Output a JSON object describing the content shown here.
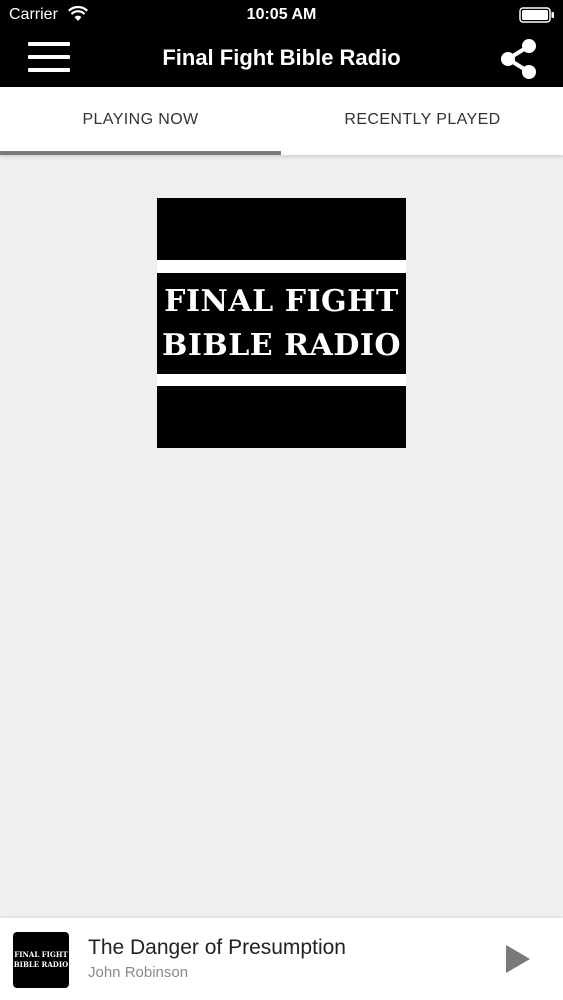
{
  "status_bar": {
    "carrier": "Carrier",
    "time": "10:05 AM"
  },
  "nav": {
    "title": "Final Fight Bible Radio",
    "menu_icon": "hamburger-menu-icon",
    "share_icon": "share-icon"
  },
  "tabs": [
    {
      "label": "PLAYING NOW",
      "active": true
    },
    {
      "label": "RECENTLY PLAYED",
      "active": false
    }
  ],
  "artwork": {
    "line1": "FINAL FIGHT",
    "line2": "BIBLE RADIO"
  },
  "mini_player": {
    "title": "The Danger of Presumption",
    "artist": "John Robinson",
    "art_line1": "FINAL FIGHT",
    "art_line2": "BIBLE RADIO",
    "play_icon": "play-icon"
  },
  "colors": {
    "bar_background": "#000000",
    "content_background": "#efeef1",
    "tab_indicator": "#7a7a7a"
  }
}
